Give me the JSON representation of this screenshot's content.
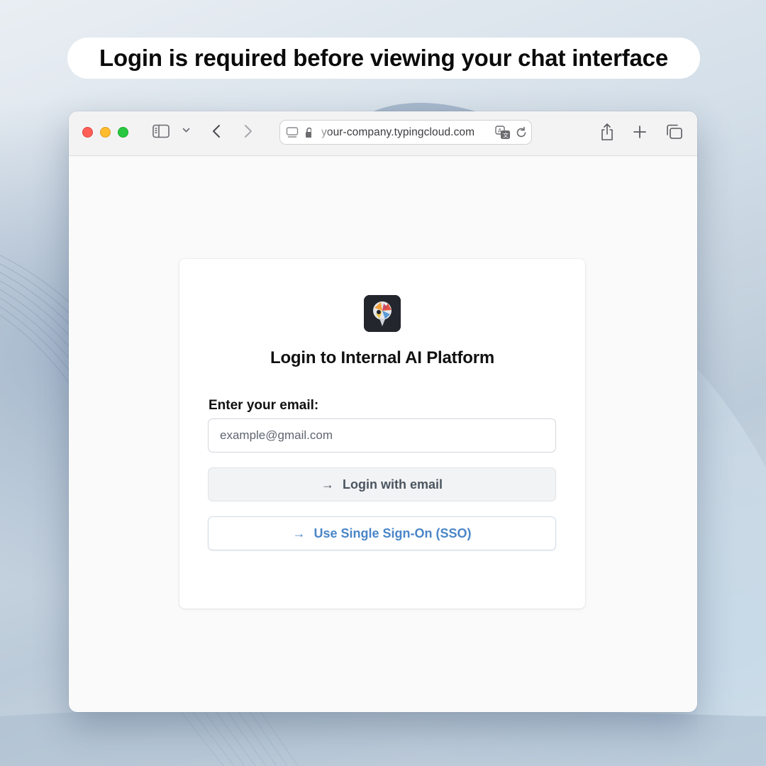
{
  "banner": {
    "text": "Login is required before viewing your chat interface"
  },
  "browser": {
    "url": "your-company.typingcloud.com",
    "icons": [
      "sidebar-icon",
      "chevron-down-icon",
      "back-icon",
      "forward-icon",
      "page-icon",
      "lock-icon",
      "translate-icon",
      "reload-icon",
      "share-icon",
      "plus-icon",
      "tabs-icon"
    ]
  },
  "login": {
    "title": "Login to Internal AI Platform",
    "email_label": "Enter your email:",
    "email_placeholder": "example@gmail.com",
    "email_value": "",
    "email_button": "Login with email",
    "sso_button": "Use Single Sign-On (SSO)",
    "arrow_glyph": "→"
  },
  "colors": {
    "accent": "#4a86c8",
    "traffic_red": "#ff5f57",
    "traffic_yellow": "#febc2e",
    "traffic_green": "#28c840"
  }
}
